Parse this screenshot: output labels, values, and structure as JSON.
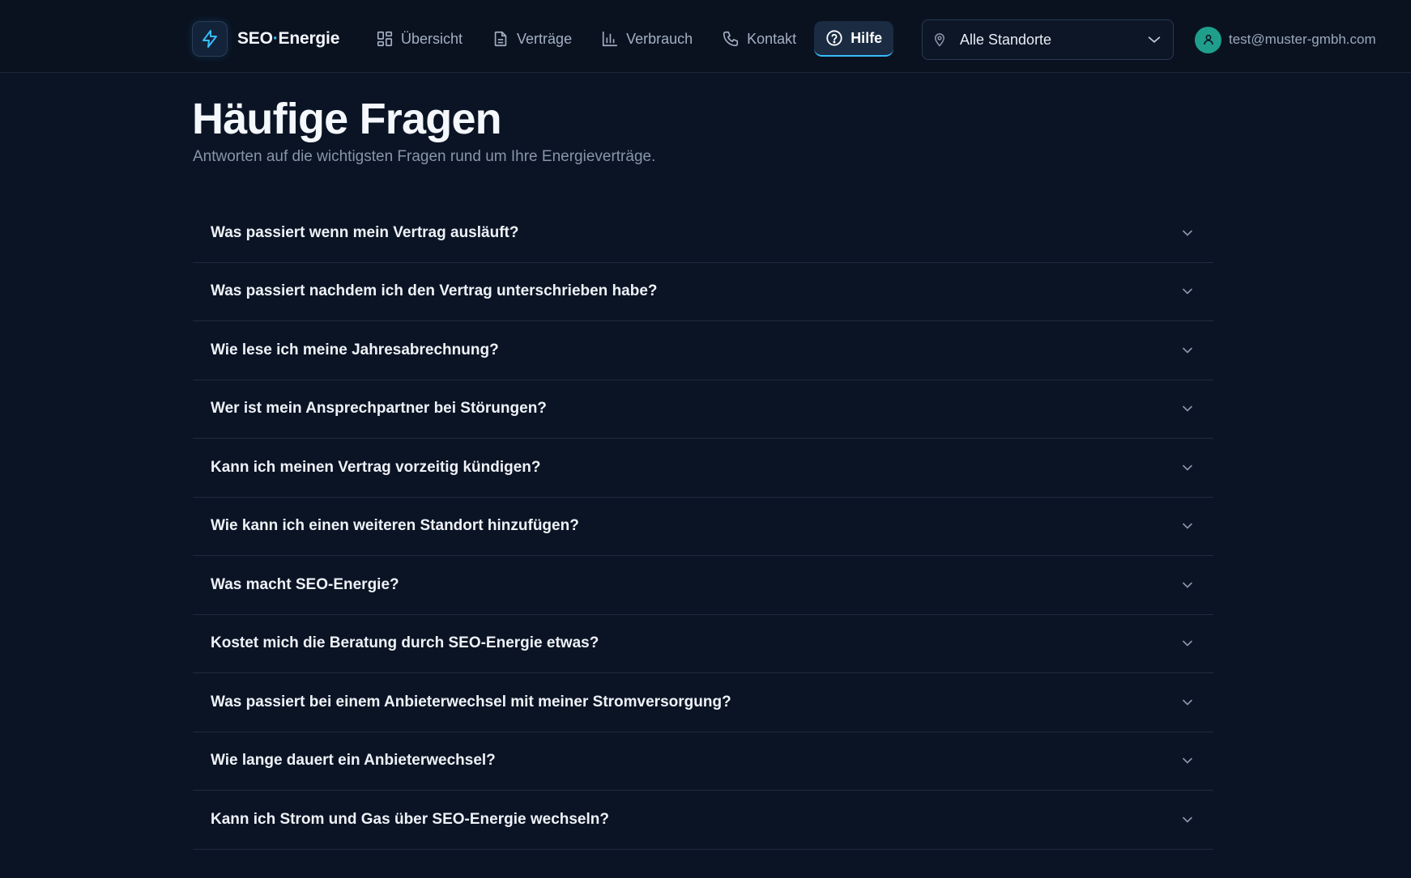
{
  "brand": {
    "name_part1": "SEO",
    "name_dot": "·",
    "name_part2": "Energie"
  },
  "nav": [
    {
      "label": "Übersicht",
      "icon": "dashboard-icon",
      "active": false
    },
    {
      "label": "Verträge",
      "icon": "document-icon",
      "active": false
    },
    {
      "label": "Verbrauch",
      "icon": "bar-chart-icon",
      "active": false
    },
    {
      "label": "Kontakt",
      "icon": "phone-icon",
      "active": false
    },
    {
      "label": "Hilfe",
      "icon": "help-circle-icon",
      "active": true
    }
  ],
  "location_select": {
    "value": "Alle Standorte"
  },
  "user": {
    "email": "test@muster-gmbh.com"
  },
  "page": {
    "title": "Häufige Fragen",
    "subtitle": "Antworten auf die wichtigsten Fragen rund um Ihre Energieverträge."
  },
  "faq": [
    "Was passiert wenn mein Vertrag ausläuft?",
    "Was passiert nachdem ich den Vertrag unterschrieben habe?",
    "Wie lese ich meine Jahresabrechnung?",
    "Wer ist mein Ansprechpartner bei Störungen?",
    "Kann ich meinen Vertrag vorzeitig kündigen?",
    "Wie kann ich einen weiteren Standort hinzufügen?",
    "Was macht SEO-Energie?",
    "Kostet mich die Beratung durch SEO-Energie etwas?",
    "Was passiert bei einem Anbieterwechsel mit meiner Stromversorgung?",
    "Wie lange dauert ein Anbieterwechsel?",
    "Kann ich Strom und Gas über SEO-Energie wechseln?"
  ],
  "colors": {
    "background": "#0b1424",
    "accent": "#38bdf8",
    "avatar": "#1f9e8c"
  }
}
